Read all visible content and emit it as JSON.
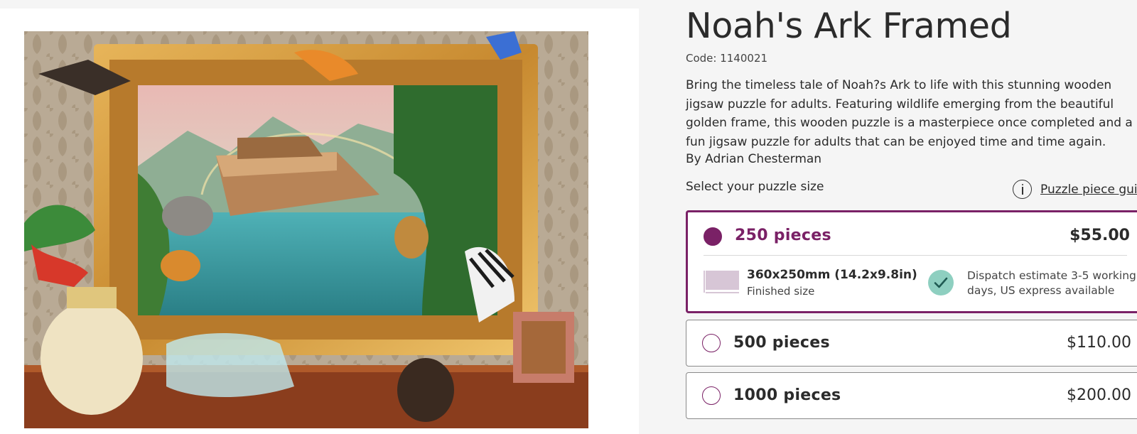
{
  "product": {
    "title": "Noah's Ark Framed",
    "code": "Code: 1140021",
    "description": "Bring the timeless tale of Noah?s Ark to life with this stunning wooden jigsaw puzzle for adults. Featuring wildlife emerging from the beautiful golden frame, this wooden puzzle is a masterpiece once completed and a fun jigsaw puzzle for adults that can be enjoyed time and time again.",
    "author": "By Adrian Chesterman",
    "image_icon": "puzzle-artwork-image"
  },
  "size_selector": {
    "label": "Select your puzzle size",
    "guide_link": "Puzzle piece guide",
    "options": [
      {
        "pieces": "250 pieces",
        "price": "$55.00",
        "selected": true,
        "dimensions": "360x250mm (14.2x9.8in)",
        "dimensions_caption": "Finished size",
        "dispatch": "Dispatch estimate 3-5 working days, US express available"
      },
      {
        "pieces": "500 pieces",
        "price": "$110.00",
        "selected": false
      },
      {
        "pieces": "1000 pieces",
        "price": "$200.00",
        "selected": false
      }
    ]
  },
  "colors": {
    "accent": "#7a2166",
    "check": "#8ecfc0",
    "size_swatch": "#d7c6d6"
  }
}
